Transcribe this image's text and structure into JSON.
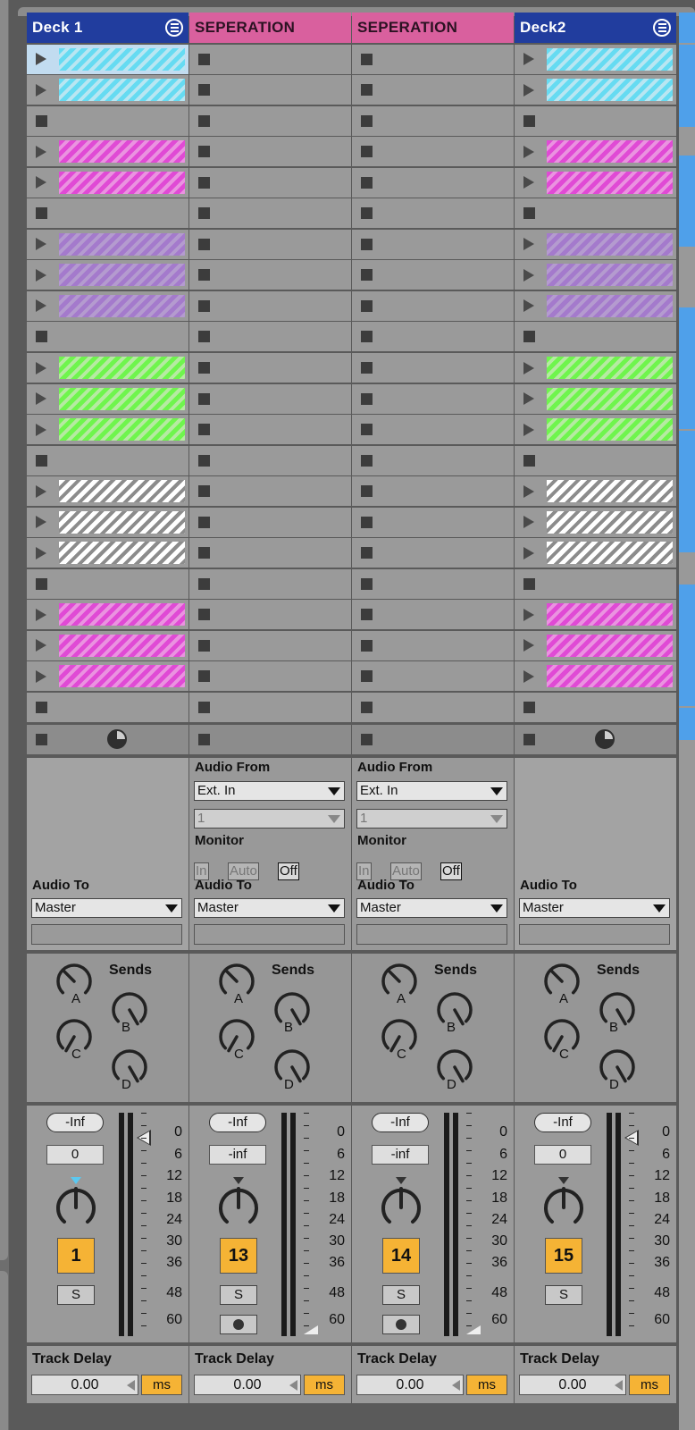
{
  "tracks": [
    {
      "name": "Deck 1",
      "type": "deck",
      "header_color": "#213d9e",
      "slots": [
        "cyan-sel",
        "cyan",
        "empty",
        "magenta",
        "magenta",
        "empty",
        "purple",
        "purple",
        "purple",
        "empty",
        "green",
        "green",
        "green",
        "empty",
        "white",
        "white",
        "white",
        "empty",
        "magenta",
        "magenta",
        "magenta",
        "empty"
      ],
      "audio_to_label": "Audio To",
      "audio_to_value": "Master",
      "sends_label": "Sends",
      "send_letters": [
        "A",
        "B",
        "C",
        "D"
      ],
      "volume": "-Inf",
      "pan": "0",
      "number": "1",
      "solo": "S",
      "meter_scale": [
        "0",
        "6",
        "12",
        "18",
        "24",
        "30",
        "36",
        "48",
        "60"
      ],
      "track_delay_label": "Track Delay",
      "track_delay_value": "0.00",
      "track_delay_unit": "ms"
    },
    {
      "name": "SEPERATION",
      "type": "sep",
      "header_color": "#d9609e",
      "slots": [
        "empty",
        "empty",
        "empty",
        "empty",
        "empty",
        "empty",
        "empty",
        "empty",
        "empty",
        "empty",
        "empty",
        "empty",
        "empty",
        "empty",
        "empty",
        "empty",
        "empty",
        "empty",
        "empty",
        "empty",
        "empty",
        "empty"
      ],
      "audio_from_label": "Audio From",
      "audio_from_value": "Ext. In",
      "audio_from_channel": "1",
      "monitor_label": "Monitor",
      "monitor_options": [
        "In",
        "Auto",
        "Off"
      ],
      "audio_to_label": "Audio To",
      "audio_to_value": "Master",
      "sends_label": "Sends",
      "send_letters": [
        "A",
        "B",
        "C",
        "D"
      ],
      "volume": "-Inf",
      "pan": "-inf",
      "number": "13",
      "solo": "S",
      "meter_scale": [
        "0",
        "6",
        "12",
        "18",
        "24",
        "30",
        "36",
        "48",
        "60"
      ],
      "track_delay_label": "Track Delay",
      "track_delay_value": "0.00",
      "track_delay_unit": "ms"
    },
    {
      "name": "SEPERATION",
      "type": "sep",
      "header_color": "#d9609e",
      "slots": [
        "empty",
        "empty",
        "empty",
        "empty",
        "empty",
        "empty",
        "empty",
        "empty",
        "empty",
        "empty",
        "empty",
        "empty",
        "empty",
        "empty",
        "empty",
        "empty",
        "empty",
        "empty",
        "empty",
        "empty",
        "empty",
        "empty"
      ],
      "audio_from_label": "Audio From",
      "audio_from_value": "Ext. In",
      "audio_from_channel": "1",
      "monitor_label": "Monitor",
      "monitor_options": [
        "In",
        "Auto",
        "Off"
      ],
      "audio_to_label": "Audio To",
      "audio_to_value": "Master",
      "sends_label": "Sends",
      "send_letters": [
        "A",
        "B",
        "C",
        "D"
      ],
      "volume": "-Inf",
      "pan": "-inf",
      "number": "14",
      "solo": "S",
      "meter_scale": [
        "0",
        "6",
        "12",
        "18",
        "24",
        "30",
        "36",
        "48",
        "60"
      ],
      "track_delay_label": "Track Delay",
      "track_delay_value": "0.00",
      "track_delay_unit": "ms"
    },
    {
      "name": "Deck2",
      "type": "deck",
      "header_color": "#213d9e",
      "slots": [
        "cyan",
        "cyan",
        "empty",
        "magenta",
        "magenta",
        "empty",
        "purple",
        "purple",
        "purple",
        "empty",
        "green",
        "green",
        "green",
        "empty",
        "white",
        "white",
        "white",
        "empty",
        "magenta",
        "magenta",
        "magenta",
        "empty"
      ],
      "audio_to_label": "Audio To",
      "audio_to_value": "Master",
      "sends_label": "Sends",
      "send_letters": [
        "A",
        "B",
        "C",
        "D"
      ],
      "volume": "-Inf",
      "pan": "0",
      "number": "15",
      "solo": "S",
      "meter_scale": [
        "0",
        "6",
        "12",
        "18",
        "24",
        "30",
        "36",
        "48",
        "60"
      ],
      "track_delay_label": "Track Delay",
      "track_delay_value": "0.00",
      "track_delay_unit": "ms"
    }
  ],
  "colors": {
    "deck_header": "#213d9e",
    "separation_header": "#d9609e",
    "track_number": "#f5b335",
    "clip_cyan": "#66dbf2",
    "clip_magenta": "#e04ad5",
    "clip_purple": "#a47acc",
    "clip_green": "#6ff54d",
    "clip_white": "#ffffff"
  },
  "icons": [
    "play-icon",
    "stop-icon",
    "menu-icon",
    "pie-icon",
    "record-icon"
  ]
}
